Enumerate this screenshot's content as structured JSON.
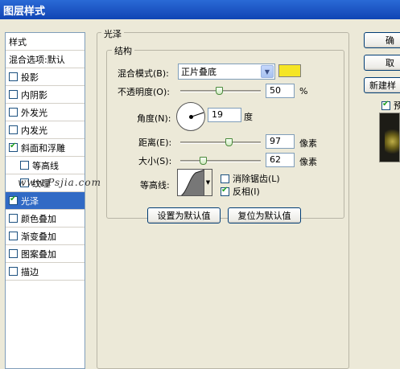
{
  "window": {
    "title": "图层样式"
  },
  "styles": {
    "header": "样式",
    "items": [
      {
        "label": "混合选项:默认",
        "checkbox": false,
        "checked": false,
        "sub": false,
        "selected": false
      },
      {
        "label": "投影",
        "checkbox": true,
        "checked": false,
        "sub": false,
        "selected": false
      },
      {
        "label": "内阴影",
        "checkbox": true,
        "checked": false,
        "sub": false,
        "selected": false
      },
      {
        "label": "外发光",
        "checkbox": true,
        "checked": false,
        "sub": false,
        "selected": false
      },
      {
        "label": "内发光",
        "checkbox": true,
        "checked": false,
        "sub": false,
        "selected": false
      },
      {
        "label": "斜面和浮雕",
        "checkbox": true,
        "checked": true,
        "sub": false,
        "selected": false
      },
      {
        "label": "等高线",
        "checkbox": true,
        "checked": false,
        "sub": true,
        "selected": false
      },
      {
        "label": "纹理",
        "checkbox": true,
        "checked": false,
        "sub": true,
        "selected": false
      },
      {
        "label": "光泽",
        "checkbox": true,
        "checked": true,
        "sub": false,
        "selected": true
      },
      {
        "label": "颜色叠加",
        "checkbox": true,
        "checked": false,
        "sub": false,
        "selected": false
      },
      {
        "label": "渐变叠加",
        "checkbox": true,
        "checked": false,
        "sub": false,
        "selected": false
      },
      {
        "label": "图案叠加",
        "checkbox": true,
        "checked": false,
        "sub": false,
        "selected": false
      },
      {
        "label": "描边",
        "checkbox": true,
        "checked": false,
        "sub": false,
        "selected": false
      }
    ]
  },
  "satin": {
    "group_title": "光泽",
    "structure_title": "结构",
    "blend_mode_label": "混合模式(B):",
    "blend_mode_value": "正片叠底",
    "blend_color": "#f5e525",
    "opacity_label": "不透明度(O):",
    "opacity_value": "50",
    "opacity_unit": "%",
    "opacity_level": 0.5,
    "angle_label": "角度(N):",
    "angle_value": "19",
    "angle_unit": "度",
    "distance_label": "距离(E):",
    "distance_value": "97",
    "distance_unit": "像素",
    "size_label": "大小(S):",
    "size_value": "62",
    "size_unit": "像素",
    "contour_label": "等高线:",
    "antialias_label": "消除锯齿(L)",
    "antialias_checked": false,
    "invert_label": "反相(I)",
    "invert_checked": true,
    "make_default_label": "设置为默认值",
    "reset_default_label": "复位为默认值"
  },
  "right_panel": {
    "ok_label": "确",
    "cancel_label": "取",
    "new_style_label": "新建样",
    "preview_label": "预",
    "preview_checked": true
  },
  "watermark": "www.Psjia.com"
}
